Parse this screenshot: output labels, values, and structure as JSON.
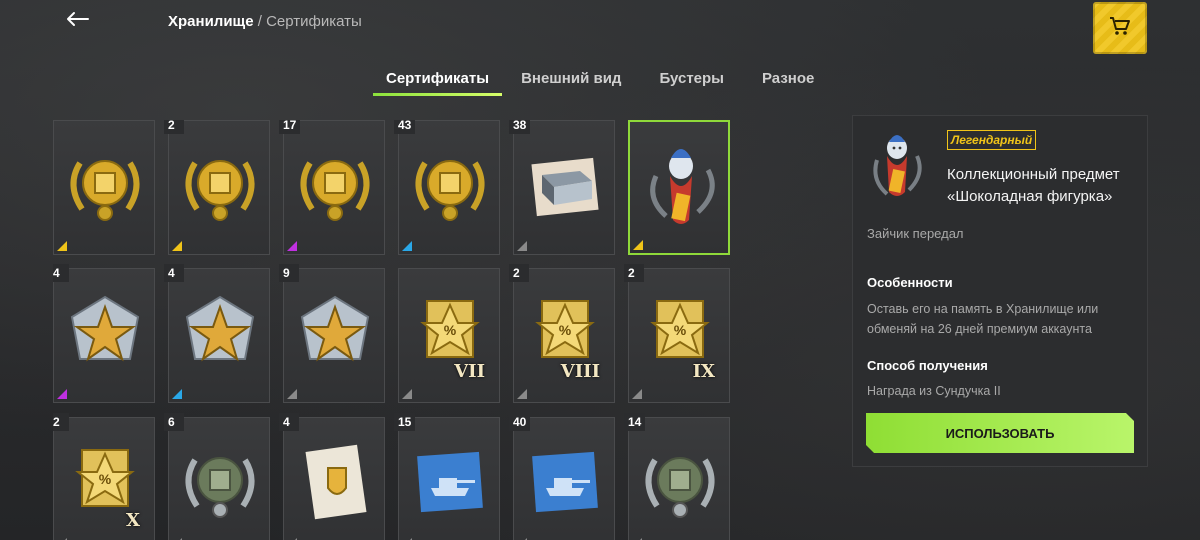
{
  "header": {
    "breadcrumb_root": "Хранилище",
    "breadcrumb_sep": "/",
    "breadcrumb_current": "Сертификаты",
    "back_icon": "arrow-left-icon",
    "cart_icon": "cart-icon"
  },
  "tabs": [
    {
      "label": "Сертификаты",
      "active": true
    },
    {
      "label": "Внешний вид",
      "active": false
    },
    {
      "label": "Бустеры",
      "active": false
    },
    {
      "label": "Разное",
      "active": false
    }
  ],
  "grid": [
    {
      "count": "",
      "icon": "gold-laurel-medal-icon",
      "rarity_color": "#f0c419"
    },
    {
      "count": "2",
      "icon": "gold-laurel-medal-icon",
      "rarity_color": "#f0c419"
    },
    {
      "count": "17",
      "icon": "gold-laurel-medal-icon",
      "rarity_color": "#c030e0"
    },
    {
      "count": "43",
      "icon": "gold-laurel-medal-icon",
      "rarity_color": "#2aa8e8"
    },
    {
      "count": "38",
      "icon": "hangar-slot-icon",
      "rarity_color": "#8a8a8a"
    },
    {
      "count": "",
      "icon": "chocolate-santa-figure-icon",
      "rarity_color": "#f0c419",
      "selected": true
    },
    {
      "count": "4",
      "icon": "silver-star-emblem-icon",
      "rarity_color": "#c030e0"
    },
    {
      "count": "4",
      "icon": "silver-star-emblem-icon",
      "rarity_color": "#2aa8e8"
    },
    {
      "count": "9",
      "icon": "silver-star-emblem-icon",
      "rarity_color": "#8a8a8a"
    },
    {
      "count": "",
      "icon": "discount-star-tier-icon",
      "tier": "VII",
      "rarity_color": "#8a8a8a"
    },
    {
      "count": "2",
      "icon": "discount-star-tier-icon",
      "tier": "VIII",
      "rarity_color": "#8a8a8a"
    },
    {
      "count": "2",
      "icon": "discount-star-tier-icon",
      "tier": "IX",
      "rarity_color": "#8a8a8a"
    },
    {
      "count": "2",
      "icon": "discount-star-tier-icon",
      "tier": "X",
      "rarity_color": "#8a8a8a"
    },
    {
      "count": "6",
      "icon": "green-laurel-medal-icon",
      "rarity_color": "#8a8a8a"
    },
    {
      "count": "4",
      "icon": "shield-document-icon",
      "rarity_color": "#8a8a8a"
    },
    {
      "count": "15",
      "icon": "tank-blueprint-icon",
      "rarity_color": "#8a8a8a"
    },
    {
      "count": "40",
      "icon": "tank-blueprint-icon",
      "rarity_color": "#8a8a8a"
    },
    {
      "count": "14",
      "icon": "green-laurel-medal-icon",
      "rarity_color": "#8a8a8a"
    }
  ],
  "details": {
    "rarity": "Легендарный",
    "title": "Коллекционный предмет «Шоколадная фигурка»",
    "from": "Зайчик передал",
    "features_heading": "Особенности",
    "features_text": "Оставь его на память в Хранилище или обменяй на 26 дней премиум аккаунта",
    "obtain_heading": "Способ получения",
    "obtain_text": "Награда из Сундучка II",
    "use_button": "ИСПОЛЬЗОВАТЬ"
  },
  "colors": {
    "accent_green": "#8fde34",
    "legendary_gold": "#f0c419"
  }
}
